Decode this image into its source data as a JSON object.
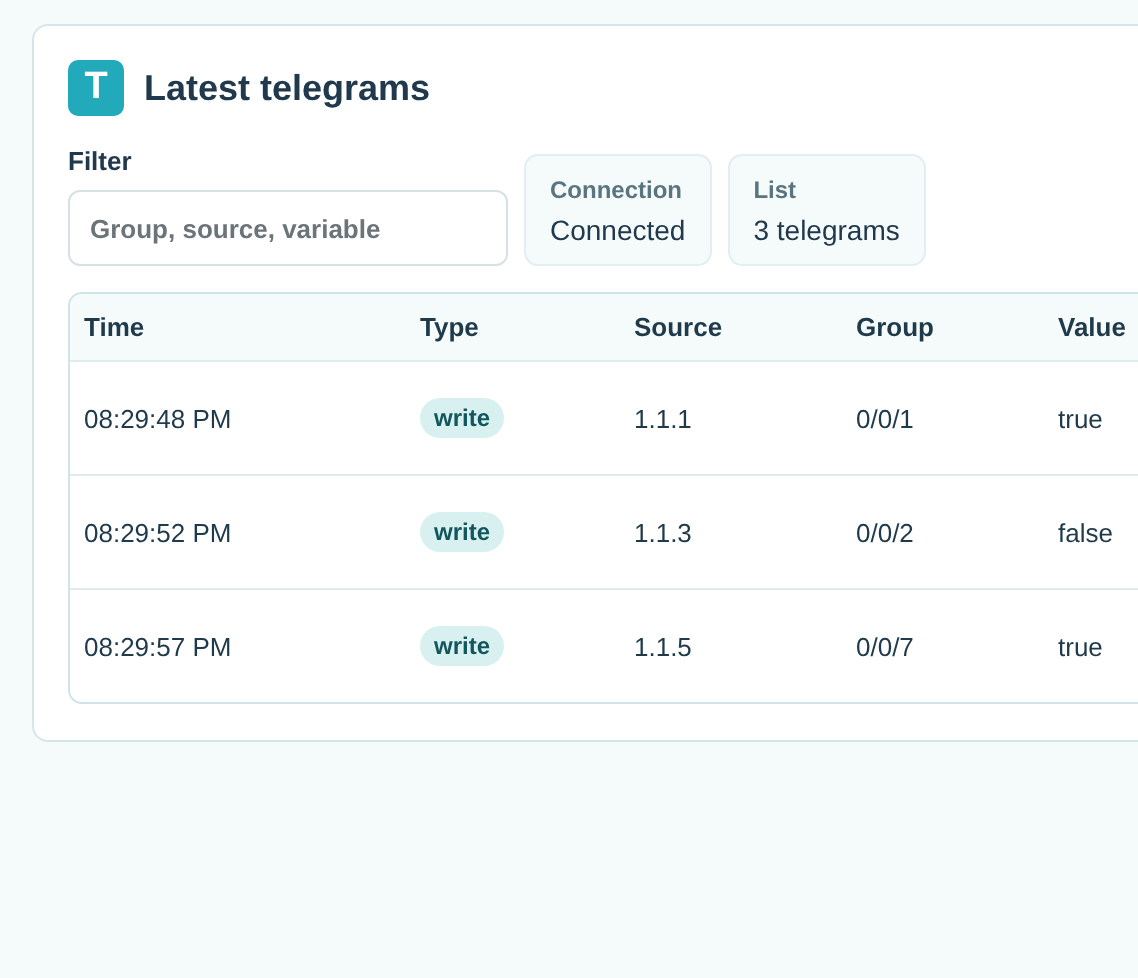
{
  "header": {
    "icon_letter": "T",
    "title": "Latest telegrams"
  },
  "filter": {
    "label": "Filter",
    "placeholder": "Group, source, variable"
  },
  "stats": [
    {
      "label": "Connection",
      "value": "Connected"
    },
    {
      "label": "List",
      "value": "3 telegrams"
    }
  ],
  "table": {
    "columns": [
      "Time",
      "Type",
      "Source",
      "Group",
      "Value"
    ],
    "rows": [
      {
        "time": "08:29:48 PM",
        "type": "write",
        "source": "1.1.1",
        "group": "0/0/1",
        "value": "true"
      },
      {
        "time": "08:29:52 PM",
        "type": "write",
        "source": "1.1.3",
        "group": "0/0/2",
        "value": "false"
      },
      {
        "time": "08:29:57 PM",
        "type": "write",
        "source": "1.1.5",
        "group": "0/0/7",
        "value": "true"
      }
    ]
  }
}
